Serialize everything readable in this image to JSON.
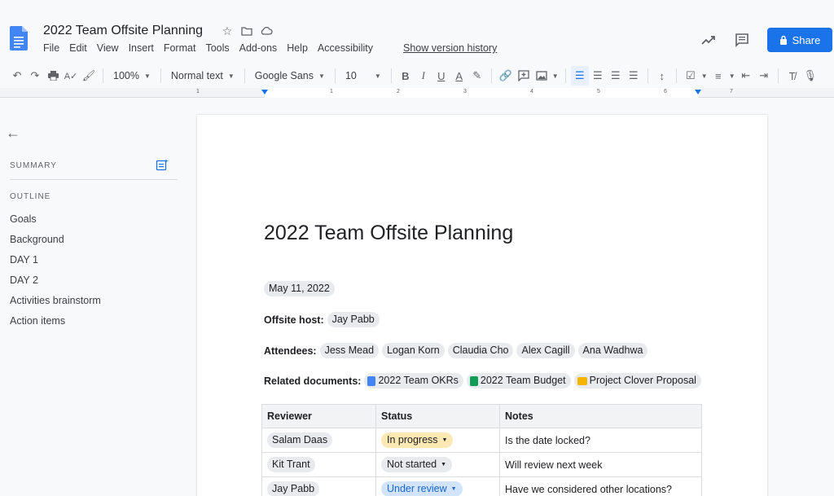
{
  "header": {
    "title": "2022 Team Offsite Planning",
    "menu": [
      "File",
      "Edit",
      "View",
      "Insert",
      "Format",
      "Tools",
      "Add-ons",
      "Help",
      "Accessibility"
    ],
    "version_history": "Show version history",
    "share_label": "Share",
    "icons": [
      "star-icon",
      "folder-icon",
      "cloud-icon",
      "trending-icon",
      "comment-icon",
      "lock-icon"
    ]
  },
  "toolbar": {
    "zoom": "100%",
    "style": "Normal text",
    "font": "Google Sans",
    "size": "10"
  },
  "ruler": {
    "numbers": [
      "1",
      "1",
      "2",
      "3",
      "4",
      "5",
      "6",
      "7"
    ]
  },
  "sidebar": {
    "summary_label": "SUMMARY",
    "outline_label": "OUTLINE",
    "outline": [
      "Goals",
      "Background",
      "DAY 1",
      "DAY 2",
      "Activities brainstorm",
      "Action items"
    ]
  },
  "doc": {
    "title": "2022 Team Offsite Planning",
    "date": "May 11, 2022",
    "host_label": "Offsite host:",
    "host": "Jay Pabb",
    "attendees_label": "Attendees:",
    "attendees": [
      "Jess Mead",
      "Logan Korn",
      "Claudia Cho",
      "Alex Cagill",
      "Ana Wadhwa"
    ],
    "related_label": "Related documents:",
    "related": [
      {
        "name": "2022 Team OKRs",
        "color": "#4285f4"
      },
      {
        "name": "2022 Team Budget",
        "color": "#0f9d58"
      },
      {
        "name": "Project Clover Proposal",
        "color": "#f4b400"
      }
    ],
    "table": {
      "headers": [
        "Reviewer",
        "Status",
        "Notes"
      ],
      "rows": [
        {
          "reviewer": "Salam Daas",
          "status": "In progress",
          "status_bg": "#fce8b2",
          "status_fg": "#202124",
          "notes": "Is the date locked?"
        },
        {
          "reviewer": "Kit Trant",
          "status": "Not started",
          "status_bg": "#e8eaed",
          "status_fg": "#202124",
          "notes": "Will review next week"
        },
        {
          "reviewer": "Jay Pabb",
          "status": "Under review",
          "status_bg": "#d2e3fc",
          "status_fg": "#1967d2",
          "notes": "Have we considered other locations?"
        }
      ]
    }
  },
  "colors": {
    "accent": "#1a73e8"
  }
}
